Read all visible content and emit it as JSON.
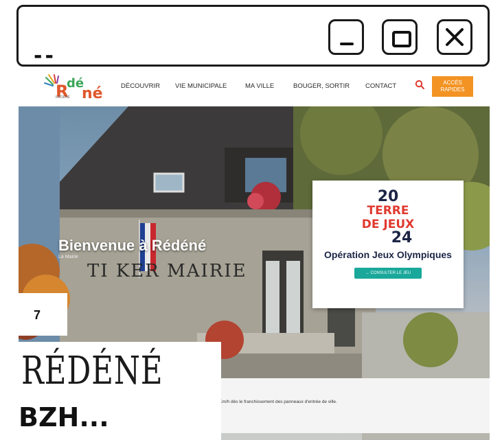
{
  "window": {
    "title": "--",
    "buttons": [
      "minimize",
      "maximize",
      "close"
    ]
  },
  "site": {
    "logo_text": "Rédéné",
    "logo_subtext": "RÉDÉNÉ",
    "nav": [
      {
        "label": "DÉCOUVRIR"
      },
      {
        "label": "VIE MUNICIPALE"
      },
      {
        "label": "MA VILLE"
      },
      {
        "label": "BOUGER, SORTIR"
      },
      {
        "label": "CONTACT"
      }
    ],
    "quick_access": "ACCÈS RAPIDES",
    "accent_color": "#f39323"
  },
  "hero": {
    "title": "Bienvenue à Rédéné",
    "subtitle": "La Mairie",
    "facade_text": "TI KER MAIRIE"
  },
  "promo": {
    "year_top": "20",
    "line1": "TERRE",
    "line2": "DE JEUX",
    "year_bottom": "24",
    "caption": "Opération Jeux Olympiques",
    "button": "→ CONSULTER LE JEU"
  },
  "info_bar": {
    "text": "Km/h dès le franchissement des panneaux d'entrée de ville."
  },
  "overlay": {
    "number": "7",
    "big_name": "RÉDÉNÉ",
    "subtitle": "BZH..."
  }
}
